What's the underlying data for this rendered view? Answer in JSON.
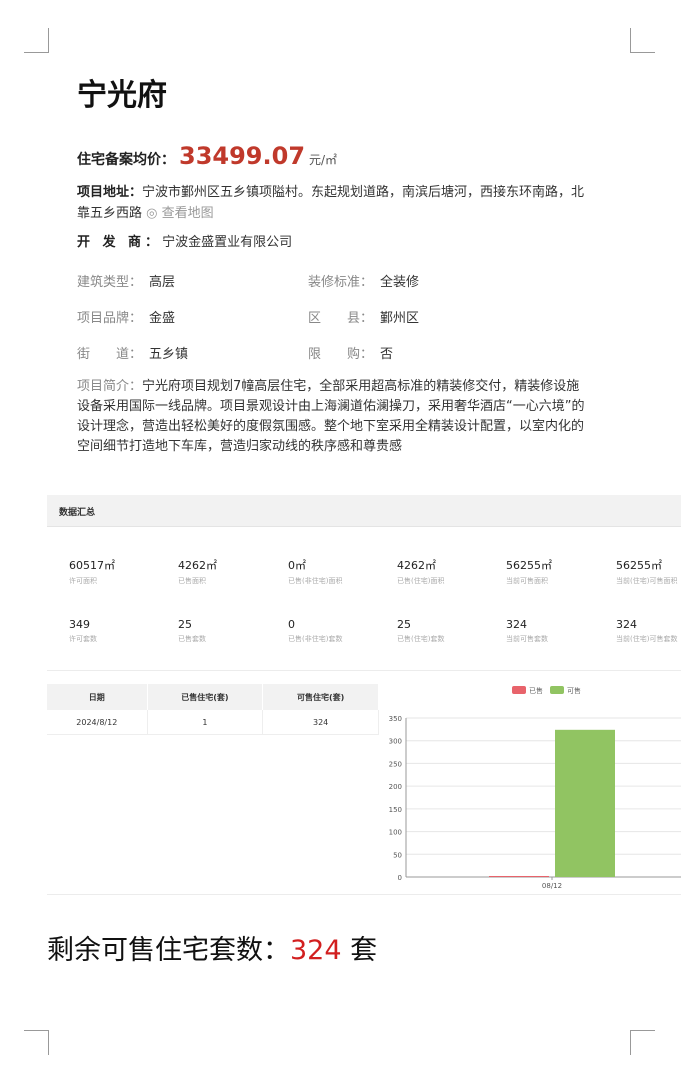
{
  "project": {
    "name": "宁光府",
    "price_label": "住宅备案均价：",
    "price_value": "33499.07",
    "price_unit": "元/㎡",
    "address_label": "项目地址：",
    "address": "宁波市鄞州区五乡镇项隘村。东起规划道路，南滨后塘河，西接东环南路，北靠五乡西路",
    "map_link": "◎ 查看地图",
    "developer_label": "开 发 商：",
    "developer": "宁波金盛置业有限公司",
    "attributes": [
      {
        "key": "建筑类型：",
        "value": "高层"
      },
      {
        "key": "装修标准：",
        "value": "全装修"
      },
      {
        "key": "项目品牌：",
        "value": "金盛"
      },
      {
        "key": "区　　县：",
        "value": "鄞州区"
      },
      {
        "key": "街　　道：",
        "value": "五乡镇"
      },
      {
        "key": "限　　购：",
        "value": "否"
      }
    ],
    "intro_label": "项目简介：",
    "intro": "宁光府项目规划7幢高层住宅，全部采用超高标准的精装修交付，精装修设施设备采用国际一线品牌。项目景观设计由上海澜道佑澜操刀，采用奢华酒店“一心六境”的设计理念，营造出轻松美好的度假氛围感。整个地下室采用全精装设计配置，以室内化的空间细节打造地下车库，营造归家动线的秩序感和尊贵感"
  },
  "summary_section": {
    "title": "数据汇总",
    "stats_row1": [
      {
        "value": "60517㎡",
        "label": "许可面积"
      },
      {
        "value": "4262㎡",
        "label": "已售面积"
      },
      {
        "value": "0㎡",
        "label": "已售(非住宅)面积"
      },
      {
        "value": "4262㎡",
        "label": "已售(住宅)面积"
      },
      {
        "value": "56255㎡",
        "label": "当前可售面积"
      },
      {
        "value": "56255㎡",
        "label": "当前(住宅)可售面积"
      }
    ],
    "stats_row2": [
      {
        "value": "349",
        "label": "许可套数"
      },
      {
        "value": "25",
        "label": "已售套数"
      },
      {
        "value": "0",
        "label": "已售(非住宅)套数"
      },
      {
        "value": "25",
        "label": "已售(住宅)套数"
      },
      {
        "value": "324",
        "label": "当前可售套数"
      },
      {
        "value": "324",
        "label": "当前(住宅)可售套数"
      }
    ]
  },
  "table": {
    "headers": [
      "日期",
      "已售住宅(套)",
      "可售住宅(套)"
    ],
    "rows": [
      [
        "2024/8/12",
        "1",
        "324"
      ]
    ]
  },
  "colors": {
    "sold": "#e8636b",
    "available": "#91c462",
    "accent_red": "#c0392b"
  },
  "chart_data": {
    "type": "bar",
    "categories": [
      "08/12"
    ],
    "series": [
      {
        "name": "已售",
        "values": [
          1
        ]
      },
      {
        "name": "可售",
        "values": [
          324
        ]
      }
    ],
    "ylim": [
      0,
      350
    ],
    "yticks": [
      0,
      50,
      100,
      150,
      200,
      250,
      300,
      350
    ],
    "legend_position": "top",
    "grid": true
  },
  "footer": {
    "prefix": "剩余可售住宅套数：",
    "count": "324",
    "suffix": " 套"
  }
}
